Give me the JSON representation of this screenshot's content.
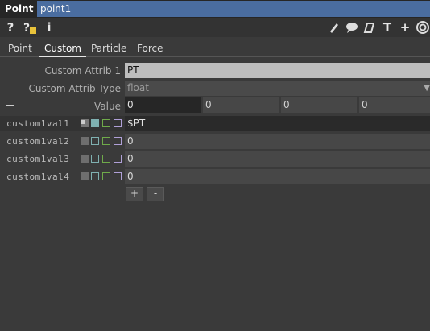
{
  "header": {
    "op_type": "Point",
    "op_name": "point1"
  },
  "toolbar": {
    "left_icons": [
      "help-icon",
      "python-help-icon",
      "info-icon"
    ],
    "right_icons": [
      "edit-icon",
      "comment-icon",
      "clone-icon",
      "text-icon",
      "add-icon",
      "target-icon"
    ]
  },
  "tabs": [
    {
      "label": "Point",
      "active": false
    },
    {
      "label": "Custom",
      "active": true
    },
    {
      "label": "Particle",
      "active": false
    },
    {
      "label": "Force",
      "active": false
    }
  ],
  "params": {
    "attrib_label": "Custom Attrib 1",
    "attrib_value": "PT",
    "type_label": "Custom Attrib Type",
    "type_value": "float",
    "value_label": "Value",
    "value_fields": [
      "0",
      "0",
      "0",
      "0"
    ]
  },
  "rows": [
    {
      "label": "custom1val1",
      "value": "$PT"
    },
    {
      "label": "custom1val2",
      "value": "0"
    },
    {
      "label": "custom1val3",
      "value": "0"
    },
    {
      "label": "custom1val4",
      "value": "0"
    }
  ],
  "buttons": {
    "add": "+",
    "remove": "-"
  },
  "collapse": "—"
}
